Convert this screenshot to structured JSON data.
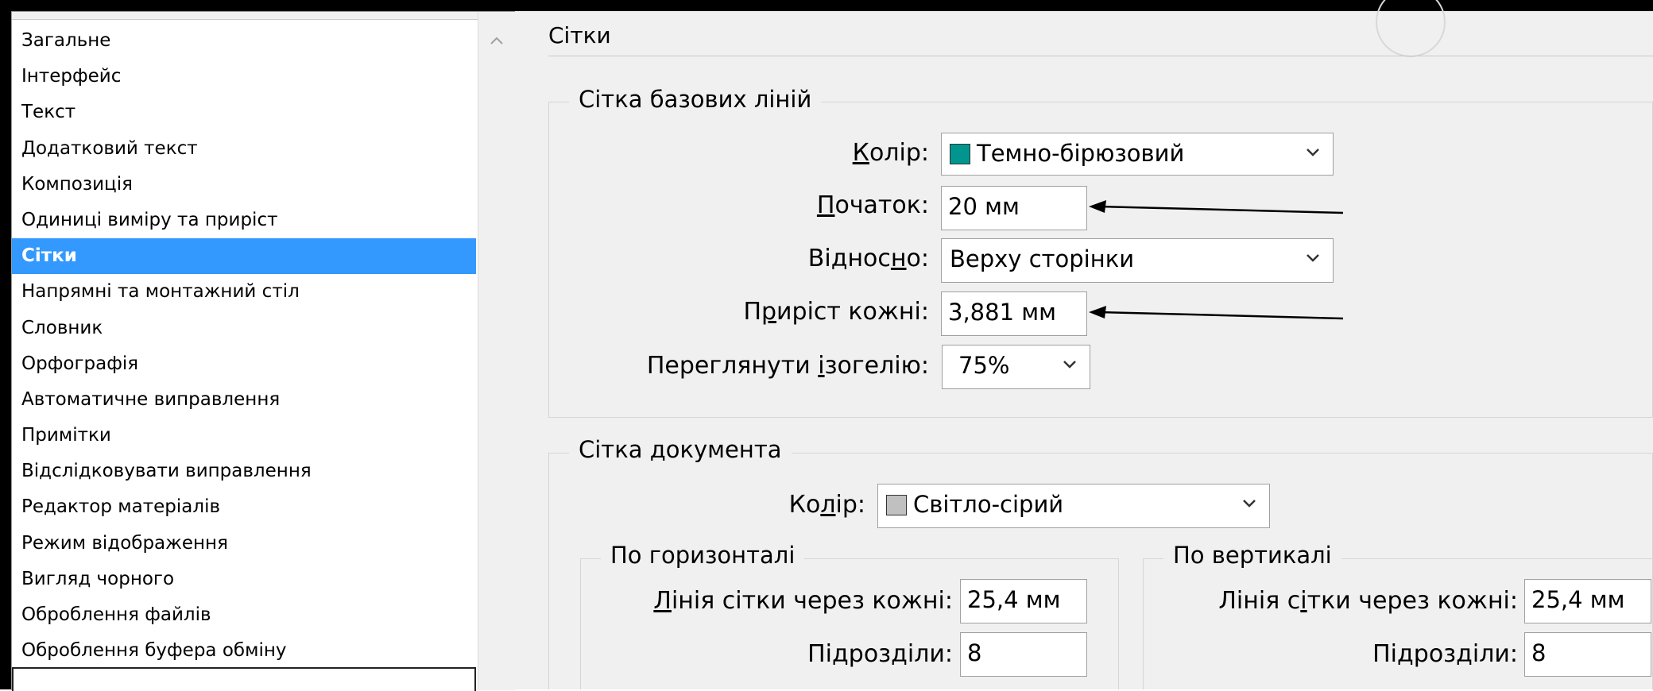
{
  "sidebar": {
    "items": [
      {
        "label": "Загальне"
      },
      {
        "label": "Інтерфейс"
      },
      {
        "label": "Текст"
      },
      {
        "label": "Додатковий текст"
      },
      {
        "label": "Композиція"
      },
      {
        "label": "Одиниці виміру та приріст"
      },
      {
        "label": "Сітки",
        "selected": true
      },
      {
        "label": "Напрямні та монтажний стіл"
      },
      {
        "label": "Словник"
      },
      {
        "label": "Орфографія"
      },
      {
        "label": "Автоматичне виправлення"
      },
      {
        "label": "Примітки"
      },
      {
        "label": "Відслідковувати виправлення"
      },
      {
        "label": "Редактор матеріалів"
      },
      {
        "label": "Режим відображення"
      },
      {
        "label": "Вигляд чорного"
      },
      {
        "label": "Оброблення файлів"
      },
      {
        "label": "Оброблення буфера обміну"
      }
    ]
  },
  "page": {
    "title": "Сітки"
  },
  "baseline_grid": {
    "legend": "Сітка базових ліній",
    "color_label_pre": "",
    "color_label_u": "К",
    "color_label_post": "олір:",
    "color_value": "Темно-бірюзовий",
    "color_swatch": "#00968f",
    "start_label_u": "П",
    "start_label_post": "очаток:",
    "start_value": "20 мм",
    "relative_label_pre": "Віднос",
    "relative_label_u": "н",
    "relative_label_post": "о:",
    "relative_value": "Верху сторінки",
    "increment_label_pre": "П",
    "increment_label_u": "р",
    "increment_label_post": "иріст кожні:",
    "increment_value": "3,881 мм",
    "view_label_pre": "Переглянути ",
    "view_label_u": "і",
    "view_label_post": "зогелію:",
    "view_value": "75%"
  },
  "document_grid": {
    "legend": "Сітка документа",
    "color_label_pre": "Ко",
    "color_label_u": "л",
    "color_label_post": "ір:",
    "color_value": "Світло-сірий",
    "color_swatch": "#c0c0c0",
    "horizontal": {
      "legend": "По горизонталі",
      "line_label_u": "Л",
      "line_label_post": "інія сітки через кожні:",
      "line_value": "25,4 мм",
      "sub_label_pre": "Пі",
      "sub_label_u": "д",
      "sub_label_post": "розділи:",
      "sub_value": "8"
    },
    "vertical": {
      "legend": "По вертикалі",
      "line_label_pre": "Лінія с",
      "line_label_u": "і",
      "line_label_post": "тки через кожні:",
      "line_value": "25,4 мм",
      "sub_label_pre": "Пі",
      "sub_label_u": "д",
      "sub_label_post": "розділи:",
      "sub_value": "8"
    }
  }
}
